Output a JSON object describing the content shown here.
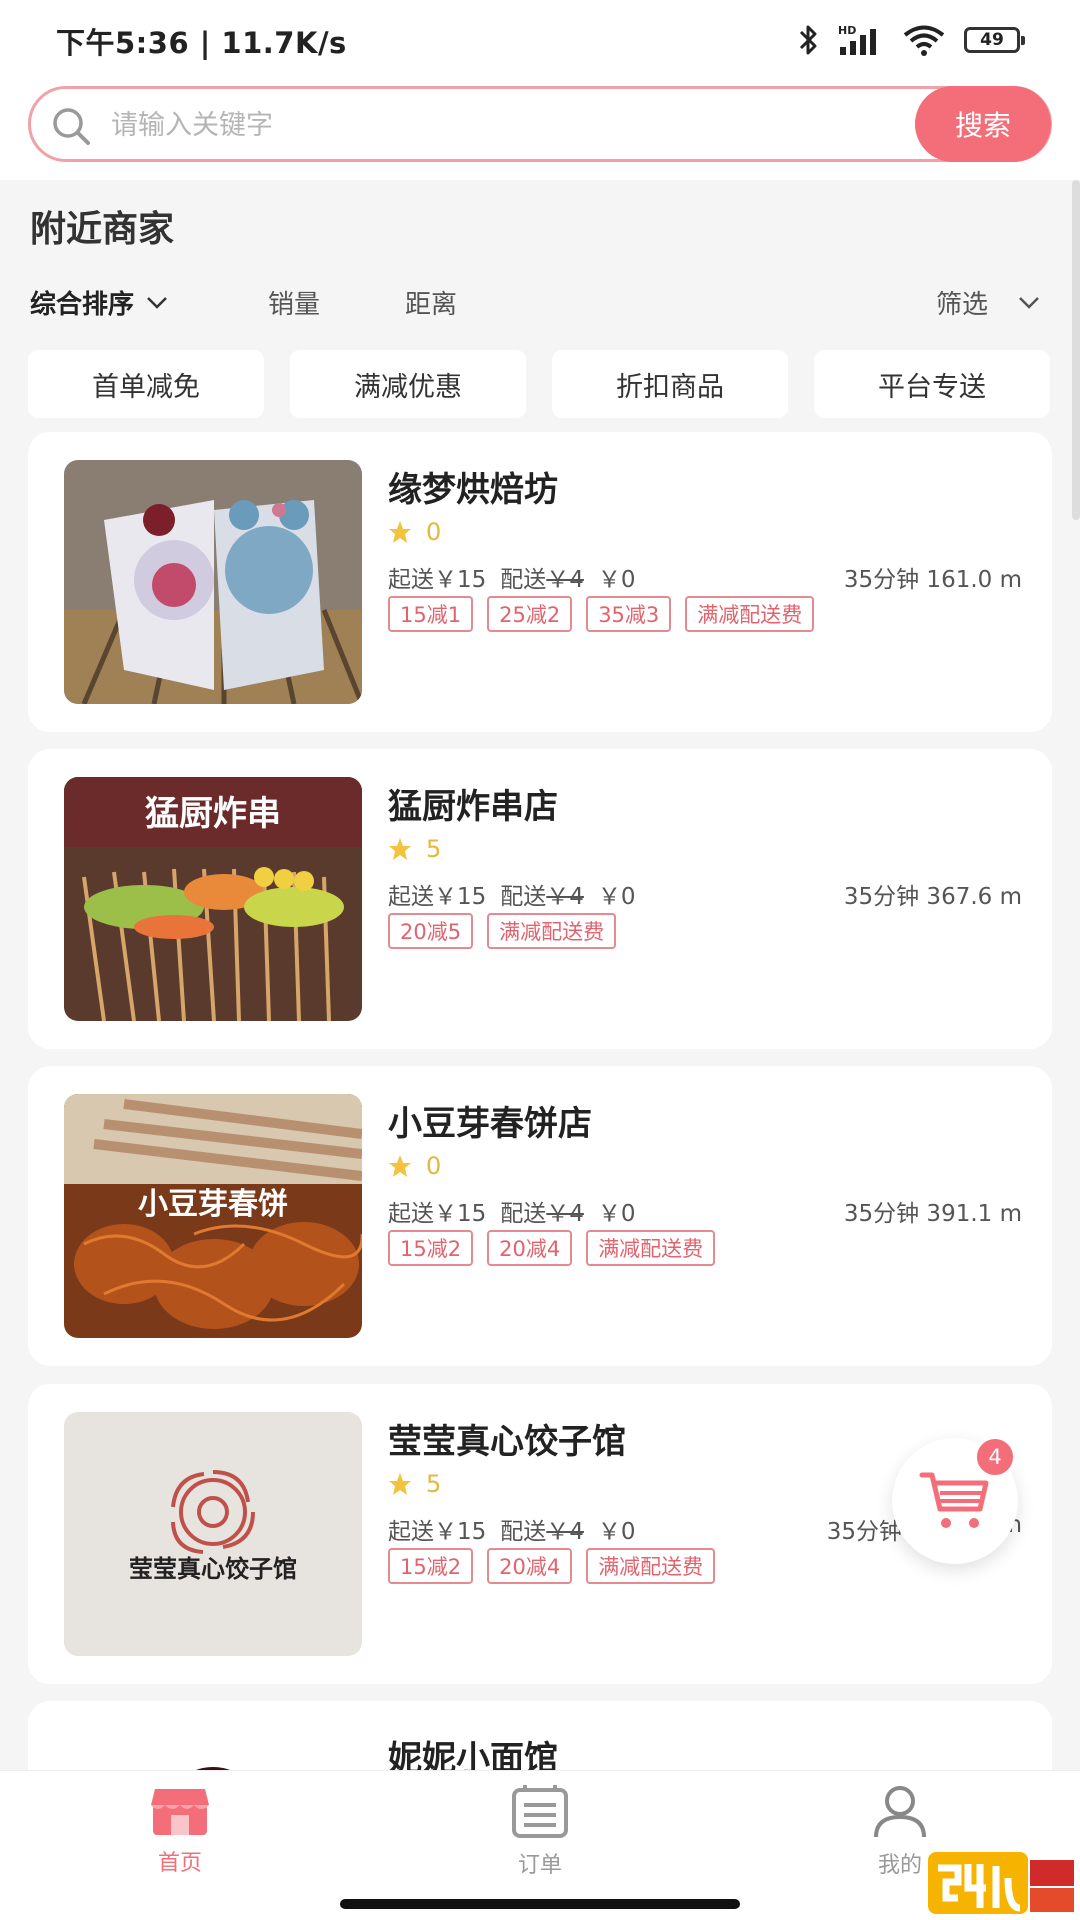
{
  "status_bar": {
    "time": "下午5:36 | 11.7K/s",
    "battery": "49",
    "network": "HD"
  },
  "search": {
    "placeholder": "请输入关键字",
    "button_label": "搜索"
  },
  "section": {
    "title": "附近商家",
    "sort_items": [
      "综合排序",
      "销量",
      "距离"
    ],
    "filter_label": "筛选"
  },
  "chips": [
    "首单减免",
    "满减优惠",
    "折扣商品",
    "平台专送"
  ],
  "stores": [
    {
      "name": "缘梦烘焙坊",
      "rating": "0",
      "min_order": "起送￥15",
      "delivery_label": "配送",
      "delivery_old": "￥4",
      "delivery_new": "￥0",
      "eta": "35分钟 161.0 m",
      "tags": [
        "15减1",
        "25减2",
        "35减3",
        "满减配送费"
      ]
    },
    {
      "name": "猛厨炸串店",
      "rating": "5",
      "min_order": "起送￥15",
      "delivery_label": "配送",
      "delivery_old": "￥4",
      "delivery_new": "￥0",
      "eta": "35分钟 367.6 m",
      "image_text": "猛厨炸串",
      "tags": [
        "20减5",
        "满减配送费"
      ]
    },
    {
      "name": "小豆芽春饼店",
      "rating": "0",
      "min_order": "起送￥15",
      "delivery_label": "配送",
      "delivery_old": "￥4",
      "delivery_new": "￥0",
      "eta": "35分钟 391.1 m",
      "image_text": "小豆芽春饼",
      "tags": [
        "15减2",
        "20减4",
        "满减配送费"
      ]
    },
    {
      "name": "莹莹真心饺子馆",
      "rating": "5",
      "min_order": "起送￥15",
      "delivery_label": "配送",
      "delivery_old": "￥4",
      "delivery_new": "￥0",
      "eta": "35分钟",
      "eta_unit": "m",
      "image_text": "莹莹真心饺子馆",
      "tags": [
        "15减2",
        "20减4",
        "满减配送费"
      ]
    },
    {
      "name": "妮妮小面馆"
    }
  ],
  "cart": {
    "badge": "4"
  },
  "bottom_nav": [
    {
      "label": "首页",
      "icon": "shop-icon",
      "active": true
    },
    {
      "label": "订单",
      "icon": "order-icon",
      "active": false
    },
    {
      "label": "我的",
      "icon": "user-icon",
      "active": false
    }
  ],
  "colors": {
    "accent": "#f36e78",
    "tag_border": "#e48a90",
    "star": "#e2b93b"
  }
}
